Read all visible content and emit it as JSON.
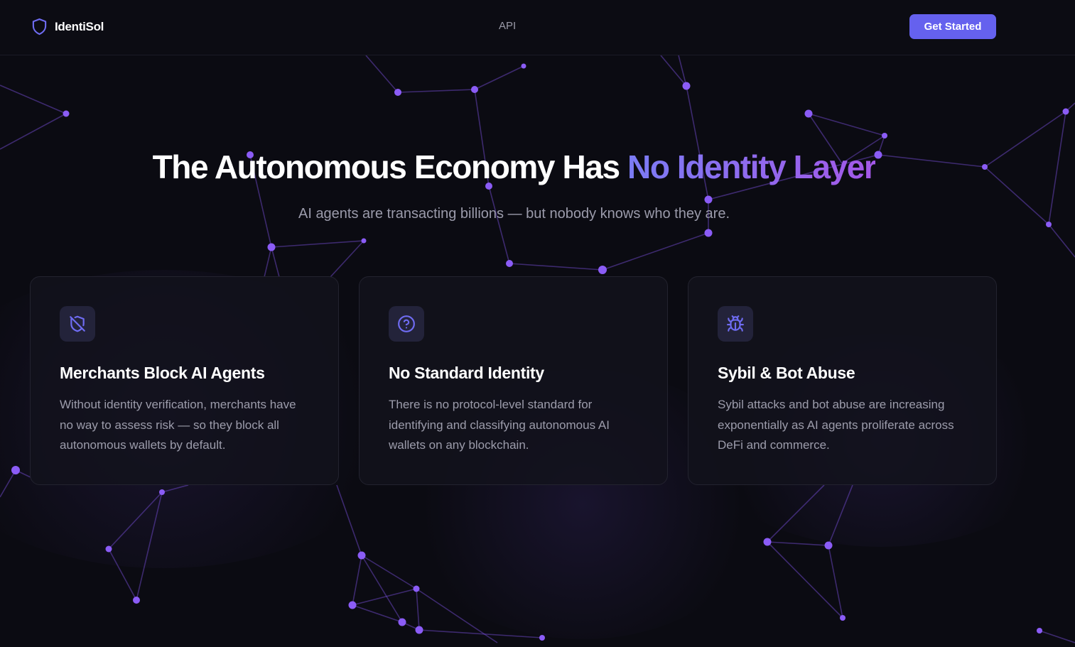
{
  "header": {
    "brand_name": "IdentiSol",
    "brand_icon": "shield-outline-icon",
    "nav": [
      {
        "label": "API"
      }
    ],
    "cta_label": "Get Started"
  },
  "hero": {
    "title_main": "The Autonomous Economy Has ",
    "title_accent": "No Identity Layer",
    "subtitle": "AI agents are transacting billions — but nobody knows who they are."
  },
  "cards": [
    {
      "icon": "shield-off-icon",
      "title": "Merchants Block AI Agents",
      "description": "Without identity verification, merchants have no way to assess risk — so they block all autonomous wallets by default."
    },
    {
      "icon": "question-circle-icon",
      "title": "No Standard Identity",
      "description": "There is no protocol-level standard for identifying and classifying autonomous AI wallets on any blockchain."
    },
    {
      "icon": "bug-icon",
      "title": "Sybil & Bot Abuse",
      "description": "Sybil attacks and bot abuse are increasing exponentially as AI agents proliferate across DeFi and commerce."
    }
  ],
  "colors": {
    "background": "#0b0b12",
    "accent_button": "#6561ee",
    "accent_gradient_start": "#7b7cf4",
    "accent_gradient_end": "#a458e8",
    "network_node": "#8b5cf6",
    "card_border": "#23232f",
    "icon_tint": "#6f6cf2"
  }
}
